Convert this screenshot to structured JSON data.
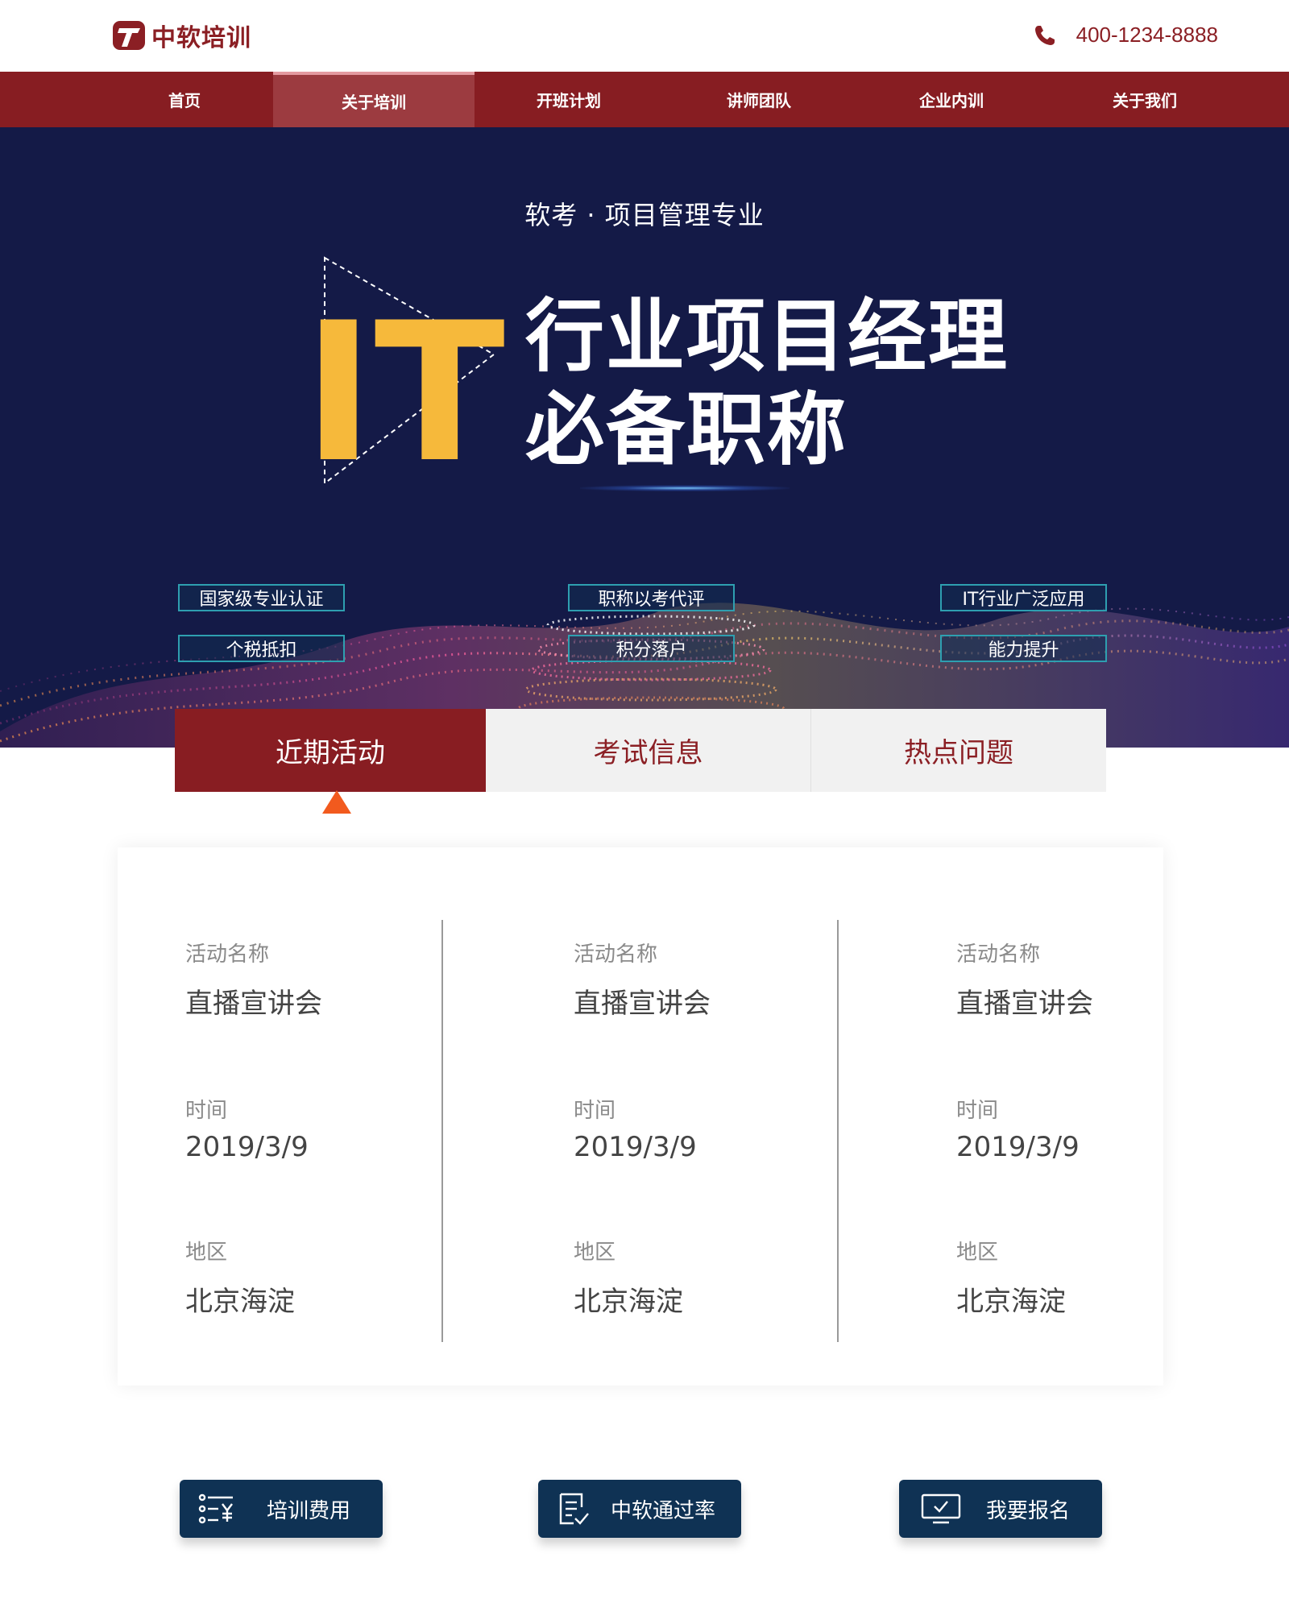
{
  "header": {
    "logo_text": "中软培训",
    "phone": "400-1234-8888"
  },
  "nav": {
    "items": [
      {
        "label": "首页"
      },
      {
        "label": "关于培训"
      },
      {
        "label": "开班计划"
      },
      {
        "label": "讲师团队"
      },
      {
        "label": "企业内训"
      },
      {
        "label": "关于我们"
      }
    ],
    "active_index": 1
  },
  "hero": {
    "subtitle": "软考 · 项目管理专业",
    "it_text": "IT",
    "title_line1": "行业项目经理",
    "title_line2": "必备职称",
    "tags": [
      "国家级专业认证",
      "职称以考代评",
      "IT行业广泛应用",
      "个税抵扣",
      "积分落户",
      "能力提升"
    ]
  },
  "tabs": [
    {
      "label": "近期活动",
      "active": true
    },
    {
      "label": "考试信息",
      "active": false
    },
    {
      "label": "热点问题",
      "active": false
    }
  ],
  "activities": [
    {
      "name_label": "活动名称",
      "name": "直播宣讲会",
      "time_label": "时间",
      "time": "2019/3/9",
      "region_label": "地区",
      "region": "北京海淀"
    },
    {
      "name_label": "活动名称",
      "name": "直播宣讲会",
      "time_label": "时间",
      "time": "2019/3/9",
      "region_label": "地区",
      "region": "北京海淀"
    },
    {
      "name_label": "活动名称",
      "name": "直播宣讲会",
      "time_label": "时间",
      "time": "2019/3/9",
      "region_label": "地区",
      "region": "北京海淀"
    }
  ],
  "actions": [
    {
      "label": "培训费用",
      "icon": "fee-list-icon"
    },
    {
      "label": "中软通过率",
      "icon": "pass-rate-document-icon"
    },
    {
      "label": "我要报名",
      "icon": "signup-monitor-icon"
    }
  ],
  "colors": {
    "brand_red": "#871d22",
    "hero_navy": "#141a47",
    "it_yellow": "#f6b93b",
    "tag_border": "#2e9fb0",
    "button_navy": "#0f3254",
    "tab_arrow": "#f25a1e"
  }
}
